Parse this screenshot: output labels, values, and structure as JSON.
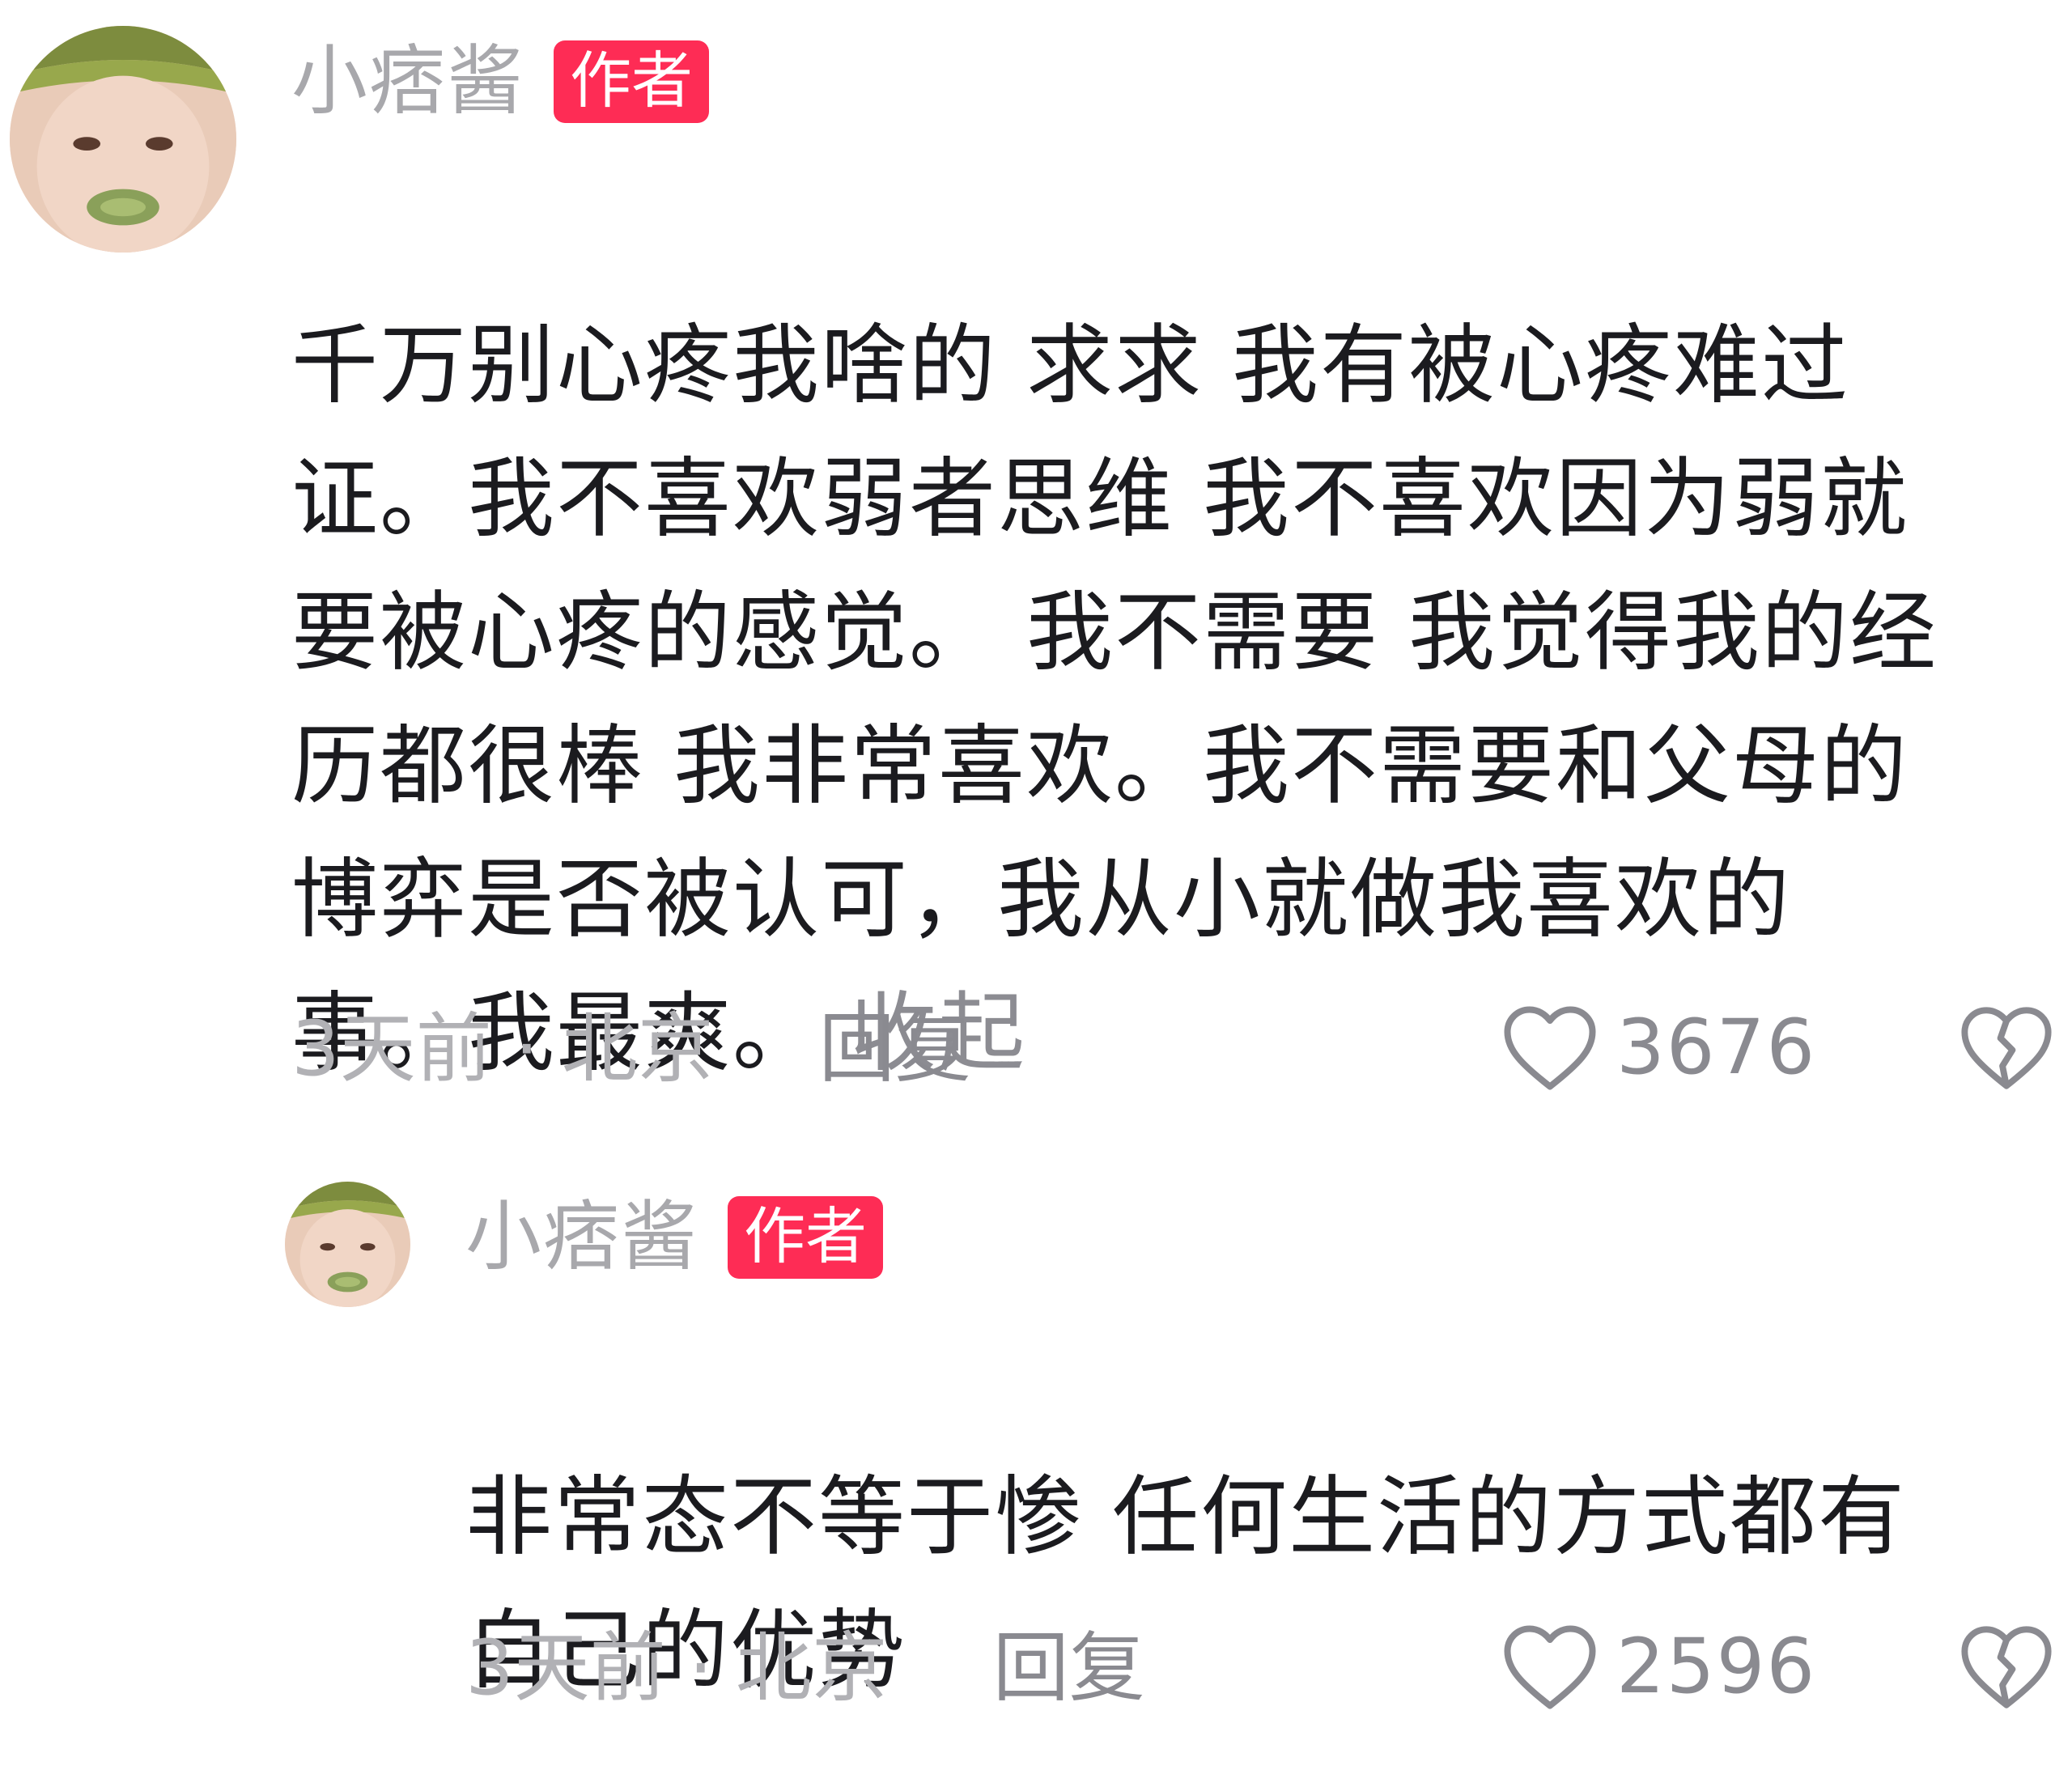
{
  "comments": [
    {
      "username": "小痞酱",
      "badge": "作者",
      "text": "千万别心疼我啥的 求求 我有被心疼难过\n证。我不喜欢弱者思维  我不喜欢因为弱就\n要被心疼的感觉。  我不需要 我觉得我的经\n历都很棒 我非常喜欢。我不需要和父母的\n博弈是否被认可，我从小就做我喜欢的\n事。我最爽。",
      "collapse_label": "收起",
      "time": "3天前",
      "separator": "·",
      "location": "北京",
      "reply_label": "回复",
      "likes": "3676"
    },
    {
      "username": "小痞酱",
      "badge": "作者",
      "text": "非常态不等于惨  任何生活的方式都有\n自己的优势",
      "time": "3天前",
      "separator": "·",
      "location": "北京",
      "reply_label": "回复",
      "likes": "2596"
    }
  ],
  "icons": {
    "like": "heart-outline-icon",
    "dislike": "broken-heart-icon"
  },
  "colors": {
    "badge": "#fe2c55",
    "text": "#1b1b1f",
    "muted": "#a8a8ac"
  }
}
